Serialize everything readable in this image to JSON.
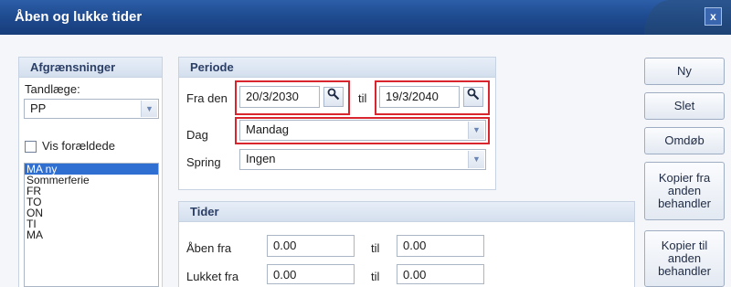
{
  "window": {
    "title": "Åben og lukke tider",
    "close_label": "x"
  },
  "afgraensninger": {
    "header": "Afgrænsninger",
    "tandlaege_label": "Tandlæge:",
    "tandlaege_value": "PP",
    "vis_foraeldede_label": "Vis forældede",
    "list_items": [
      "MA ny",
      "Sommerferie",
      "FR",
      "TO",
      "ON",
      "TI",
      "MA"
    ]
  },
  "periode": {
    "header": "Periode",
    "fra_label": "Fra den",
    "fra_value": "20/3/2030",
    "til_label": "til",
    "til_value": "19/3/2040",
    "dag_label": "Dag",
    "dag_value": "Mandag",
    "spring_label": "Spring",
    "spring_value": "Ingen"
  },
  "tider": {
    "header": "Tider",
    "aaben_label": "Åben fra",
    "aaben_from": "0.00",
    "aaben_til_label": "til",
    "aaben_to": "0.00",
    "lukket_label": "Lukket fra",
    "lukket_from": "0.00",
    "lukket_til_label": "til",
    "lukket_to": "0.00"
  },
  "buttons": {
    "ny": "Ny",
    "slet": "Slet",
    "omdob": "Omdøb",
    "kopier_fra": "Kopier fra anden behandler",
    "kopier_til": "Kopier til anden behandler"
  },
  "highlight_color": "#d9262e"
}
